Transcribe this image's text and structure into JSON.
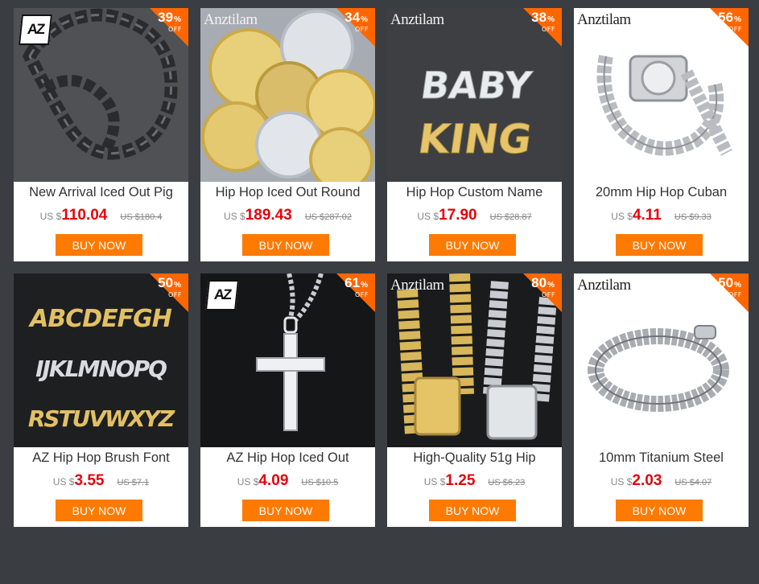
{
  "badge_color": "#ff6600",
  "buy_color": "#ff7a00",
  "price_color": "#e8000b",
  "currency_prefix": "US $",
  "buy_label": "BUY NOW",
  "percent_sign": "%",
  "off_label": "OFF",
  "products": [
    {
      "title": "New Arrival Iced Out Pig",
      "price": "110.04",
      "old_price": "US $180.4",
      "discount": "39",
      "brand_logo": "AZ",
      "image": "black-chain-necklace"
    },
    {
      "title": "Hip Hop Iced Out Round",
      "price": "189.43",
      "old_price": "US $287.02",
      "discount": "34",
      "brand_logo": "Anztilam",
      "image": "round-pendants"
    },
    {
      "title": "Hip Hop Custom Name",
      "price": "17.90",
      "old_price": "US $28.87",
      "discount": "38",
      "brand_logo": "Anztilam",
      "image": "baby-king-pendant",
      "image_text": [
        "BABY",
        "KING"
      ]
    },
    {
      "title": "20mm Hip Hop Cuban",
      "price": "4.11",
      "old_price": "US $9.33",
      "discount": "56",
      "brand_logo": "Anztilam",
      "image": "cuban-chain-watch"
    },
    {
      "title": "AZ Hip Hop Brush Font",
      "price": "3.55",
      "old_price": "US $7.1",
      "discount": "50",
      "brand_logo": "",
      "image": "letter-pendants",
      "image_text": [
        "ABCDEFGH",
        "IJKLMNOPQ",
        "RSTUVWXYZ"
      ]
    },
    {
      "title": "AZ Hip Hop Iced Out",
      "price": "4.09",
      "old_price": "US $10.5",
      "discount": "61",
      "brand_logo": "AZ",
      "image": "cross-pendant"
    },
    {
      "title": "High-Quality 51g Hip",
      "price": "1.25",
      "old_price": "US $6.23",
      "discount": "80",
      "brand_logo": "Anztilam",
      "image": "gold-silver-bracelets"
    },
    {
      "title": "10mm Titanium Steel",
      "price": "2.03",
      "old_price": "US $4.07",
      "discount": "50",
      "brand_logo": "Anztilam",
      "image": "steel-bracelet"
    }
  ]
}
